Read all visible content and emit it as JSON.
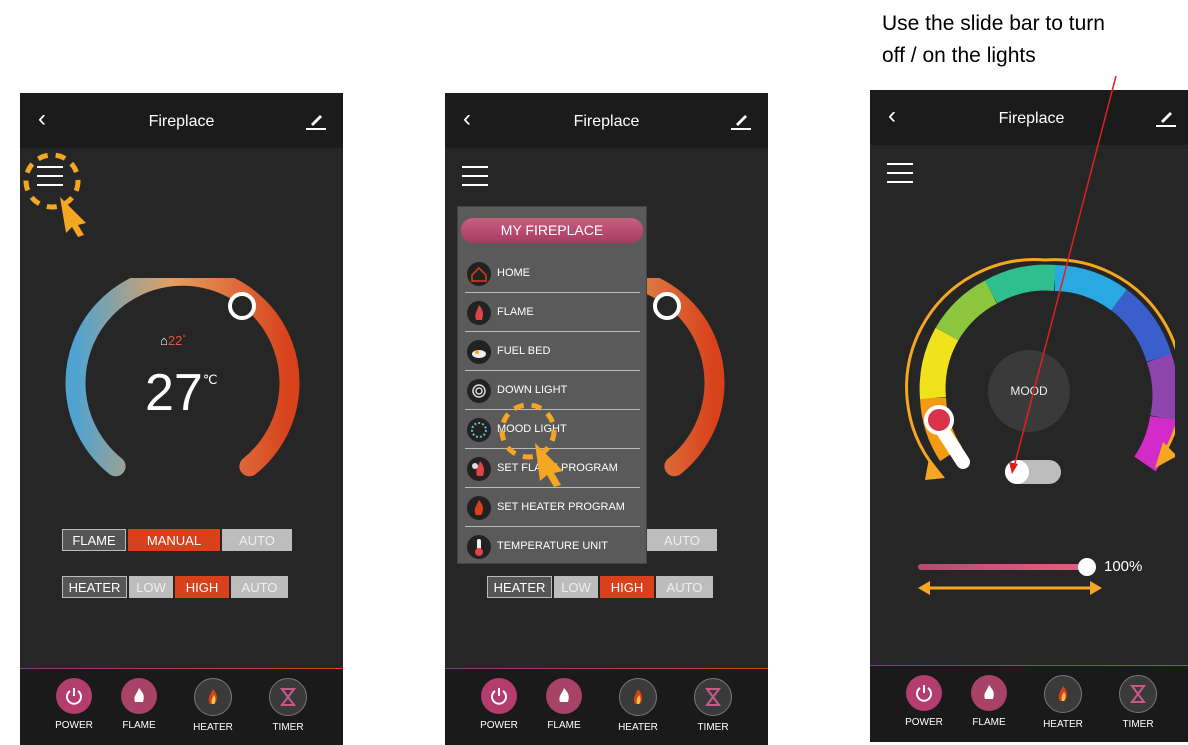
{
  "annotation": {
    "line1": "Use the slide bar to turn",
    "line2": "off / on the lights"
  },
  "screens": [
    {
      "title": "Fireplace",
      "indoor_temp": "22",
      "indoor_unit": "°",
      "set_temp": "27",
      "temp_unit": "℃"
    },
    {
      "title": "Fireplace"
    },
    {
      "title": "Fireplace",
      "mood_label": "MOOD",
      "brightness": "100%"
    }
  ],
  "controls": {
    "flame": {
      "label": "FLAME",
      "options": [
        "MANUAL",
        "AUTO"
      ],
      "selected": "MANUAL"
    },
    "heater": {
      "label": "HEATER",
      "options": [
        "LOW",
        "HIGH",
        "AUTO"
      ],
      "selected": "HIGH"
    }
  },
  "menu": {
    "title": "MY FIREPLACE",
    "items": [
      "HOME",
      "FLAME",
      "FUEL BED",
      "DOWN LIGHT",
      "MOOD LIGHT",
      "SET FLAME PROGRAM",
      "SET HEATER PROGRAM",
      "TEMPERATURE UNIT"
    ]
  },
  "nav": [
    {
      "label": "POWER",
      "icon": "power-icon",
      "color": "#b33d6d"
    },
    {
      "label": "FLAME",
      "icon": "flame-3d-icon",
      "color": "#a84267"
    },
    {
      "label": "HEATER",
      "icon": "heater-flame-icon",
      "color": "#3a3a3a"
    },
    {
      "label": "TIMER",
      "icon": "hourglass-icon",
      "color": "#3a3a3a"
    }
  ],
  "colors": {
    "accent_red": "#d8411b",
    "highlight": "#f5a623",
    "annot_arrow": "#e02020",
    "header_bg": "#1b1b1b",
    "screen_bg": "#262626"
  }
}
